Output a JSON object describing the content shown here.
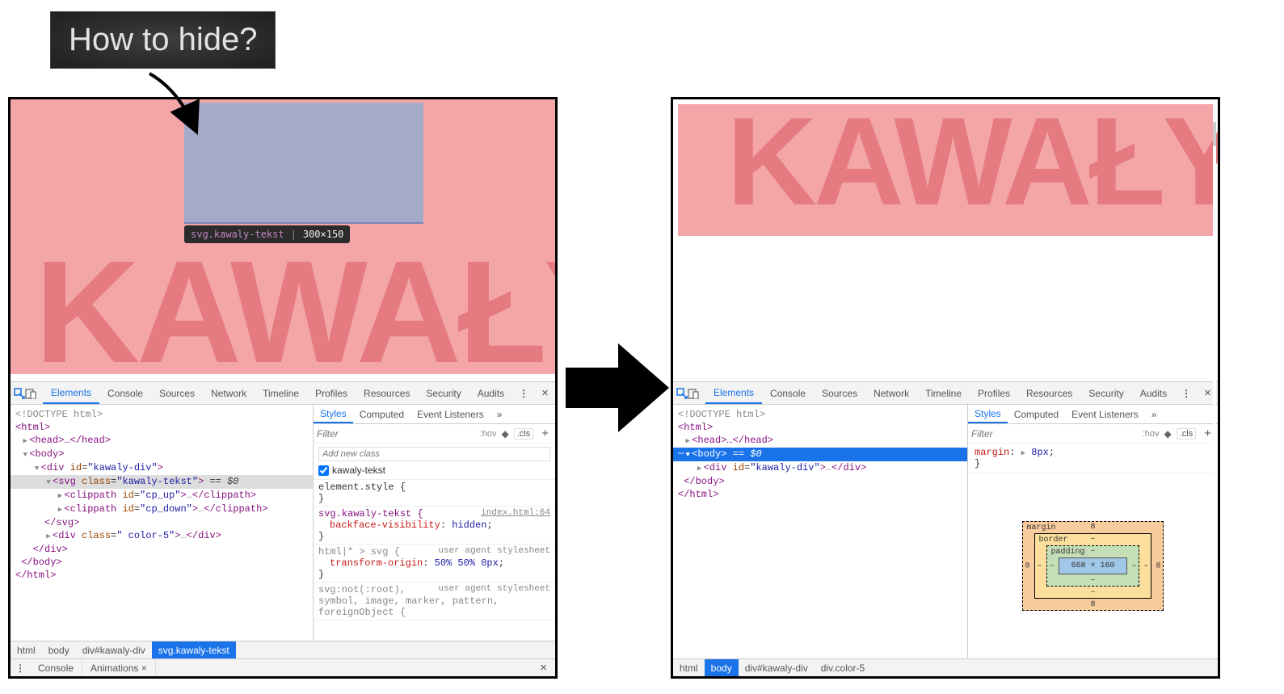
{
  "callout": "How to hide?",
  "big_text": "KAWAŁY",
  "svg_tooltip": {
    "selector": "svg.kawaly-tekst",
    "dims": "300×150"
  },
  "devtools_tabs": [
    "Elements",
    "Console",
    "Sources",
    "Network",
    "Timeline",
    "Profiles",
    "Resources",
    "Security",
    "Audits"
  ],
  "styles_tabs": [
    "Styles",
    "Computed",
    "Event Listeners"
  ],
  "filter_placeholder": "Filter",
  "hov": ":hov",
  "cls": ".cls",
  "add_class_placeholder": "Add new class",
  "class_checkbox": "kawaly-tekst",
  "left": {
    "dom": {
      "doctype": "<!DOCTYPE html>",
      "html_open": "<html>",
      "head": "<head>…</head>",
      "body_open": "<body>",
      "div_kawaly": "<div id=\"kawaly-div\">",
      "svg_open_a": "<svg class=\"",
      "svg_open_b": "kawaly-tekst",
      "svg_open_c": "\">",
      "eq_annot": " == $0",
      "clip_up": "<clippath id=\"cp_up\">…</clippath>",
      "clip_down": "<clippath id=\"cp_down\">…</clippath>",
      "svg_close": "</svg>",
      "div_color": "<div class=\" color-5\">…</div>",
      "div_close": "</div>",
      "body_close": "</body>",
      "html_close": "</html>"
    },
    "crumbs": [
      "html",
      "body",
      "div#kawaly-div",
      "svg.kawaly-tekst"
    ],
    "drawer": [
      "Console",
      "Animations ×"
    ],
    "styles": {
      "element_style": "element.style {",
      "rule1_sel": "svg.kawaly-tekst {",
      "rule1_src": "index.html:64",
      "rule1_prop": "backface-visibility",
      "rule1_val": "hidden",
      "rule2_sel": "html|* > svg {",
      "rule2_src": "user agent stylesheet",
      "rule2_prop": "transform-origin",
      "rule2_val": "50% 50% 0px",
      "rule3_sel": "svg:not(:root), symbol, image, marker, pattern, foreignObject {",
      "rule3_src": "user agent stylesheet"
    }
  },
  "right": {
    "dom": {
      "doctype": "<!DOCTYPE html>",
      "html_open": "<html>",
      "head": "<head>…</head>",
      "body_open": "<body>",
      "eq_annot": " == $0",
      "div_kawaly": "<div id=\"kawaly-div\">…</div>",
      "body_close": "</body>",
      "html_close": "</html>"
    },
    "crumbs": [
      "html",
      "body",
      "div#kawaly-div",
      "div.color-5"
    ],
    "rule": {
      "prop": "margin",
      "val": "8px"
    },
    "boxmodel": {
      "margin_label": "margin",
      "border_label": "border",
      "padding_label": "padding",
      "content": "668 × 160",
      "m": "8",
      "dash": "–"
    }
  }
}
